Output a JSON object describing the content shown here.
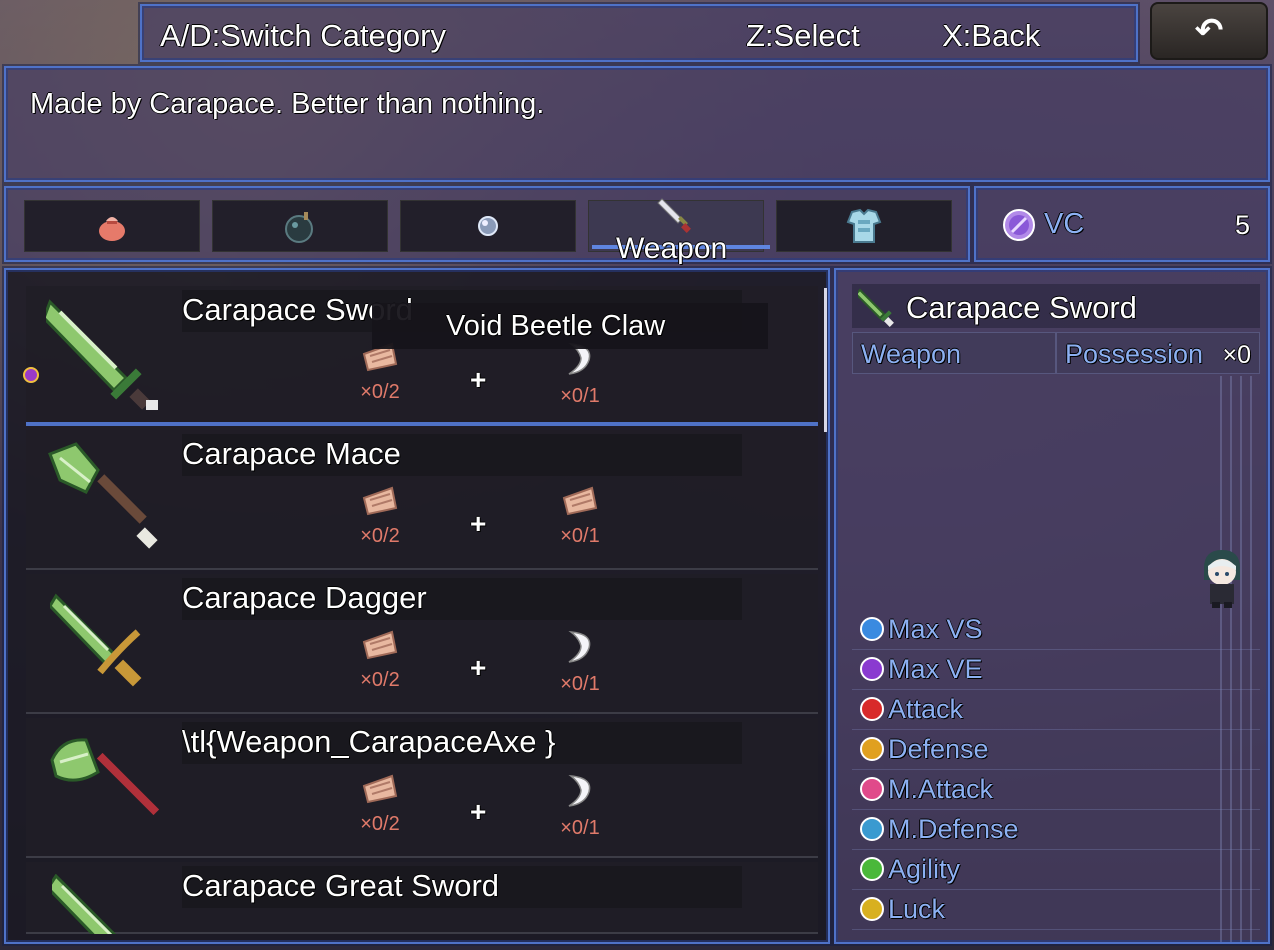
{
  "header": {
    "hint_switch": "A/D:Switch Category",
    "hint_select": "Z:Select",
    "hint_back": "X:Back",
    "back_button_glyph": "↶"
  },
  "description": "Made by Carapace. Better than nothing.",
  "tabs": {
    "active_label": "Weapon",
    "items": [
      {
        "icon": "pouch-icon"
      },
      {
        "icon": "bomb-icon"
      },
      {
        "icon": "orb-icon"
      },
      {
        "icon": "sword-icon"
      },
      {
        "icon": "armor-icon"
      }
    ]
  },
  "currency": {
    "label": "VC",
    "value": "5"
  },
  "tooltip": "Void Beetle Claw",
  "recipes": [
    {
      "name": "Carapace Sword",
      "mat1_count": "×0/2",
      "mat2_count": "×0/1",
      "plus": "+"
    },
    {
      "name": "Carapace Mace",
      "mat1_count": "×0/2",
      "mat2_count": "×0/1",
      "plus": "+"
    },
    {
      "name": "Carapace Dagger",
      "mat1_count": "×0/2",
      "mat2_count": "×0/1",
      "plus": "+"
    },
    {
      "name": "\\tl{Weapon_CarapaceAxe }",
      "mat1_count": "×0/2",
      "mat2_count": "×0/1",
      "plus": "+"
    },
    {
      "name": "Carapace Great Sword"
    }
  ],
  "detail": {
    "title": "Carapace Sword",
    "type_label": "Weapon",
    "possession_label": "Possession",
    "possession_value": "×0",
    "stats": [
      "Max VS",
      "Max VE",
      "Attack",
      "Defense",
      "M.Attack",
      "M.Defense",
      "Agility",
      "Luck"
    ]
  },
  "colors": {
    "frame_blue": "#4f72c8",
    "stat_label": "#8cb0f2",
    "count_red": "#e07a6a",
    "vc_purple": "#a070e0"
  }
}
